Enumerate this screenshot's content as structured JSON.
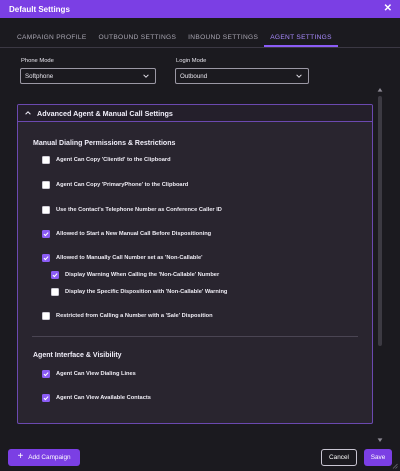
{
  "window": {
    "title": "Default Settings",
    "close_icon": "close-icon"
  },
  "tabs": [
    {
      "label": "CAMPAIGN PROFILE",
      "active": false
    },
    {
      "label": "OUTBOUND SETTINGS",
      "active": false
    },
    {
      "label": "INBOUND SETTINGS",
      "active": false
    },
    {
      "label": "AGENT SETTINGS",
      "active": true
    }
  ],
  "phone_mode": {
    "label": "Phone Mode",
    "value": "Softphone"
  },
  "login_mode": {
    "label": "Login Mode",
    "value": "Outbound"
  },
  "panel": {
    "title": "Advanced Agent & Manual Call Settings",
    "manual": {
      "title": "Manual Dialing Permissions & Restrictions",
      "items": [
        {
          "label": "Agent Can Copy 'ClientId' to the Clipboard",
          "checked": false
        },
        {
          "label": "Agent Can Copy 'PrimaryPhone' to the Clipboard",
          "checked": false
        },
        {
          "label": "Use the Contact's Telephone Number as Conference Caller ID",
          "checked": false
        },
        {
          "label": "Allowed to Start a New Manual Call Before Dispositioning",
          "checked": true
        },
        {
          "label": "Allowed to Manually Call Number set as 'Non-Callable'",
          "checked": true
        },
        {
          "label": "Display Warning When Calling the 'Non-Callable' Number",
          "checked": true
        },
        {
          "label": "Display the Specific Disposition with 'Non-Callable' Warning",
          "checked": false
        },
        {
          "label": "Restricted from Calling a Number with a 'Sale' Disposition",
          "checked": false
        }
      ]
    },
    "interface": {
      "title": "Agent Interface & Visibility",
      "items": [
        {
          "label": "Agent Can View Dialing Lines",
          "checked": true
        },
        {
          "label": "Agent Can View Available Contacts",
          "checked": true
        }
      ]
    }
  },
  "footer": {
    "add_campaign": "Add Campaign",
    "cancel": "Cancel",
    "save": "Save"
  },
  "colors": {
    "accent": "#7b3fe4",
    "background": "#1b1a1f",
    "panel": "#29252f",
    "checkbox_on": "#8b5cf6"
  }
}
